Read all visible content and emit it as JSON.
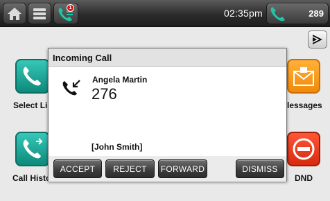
{
  "status_bar": {
    "time": "02:35pm",
    "line_number": "289",
    "missed_calls_badge": "1"
  },
  "tiles": {
    "select_line": "Select Li",
    "messages": "lessages",
    "call_history": "Call Histo",
    "dnd": "DND"
  },
  "icons": {
    "home": "home-icon",
    "list": "list-icon",
    "call_log": "call-log-icon",
    "line": "phone-icon",
    "next_page": "play-arrow-icon",
    "message": "envelope-icon",
    "dnd": "no-entry-icon",
    "incoming": "incoming-call-icon"
  },
  "colors": {
    "accent_teal": "#14a394",
    "accent_orange": "#f5960f",
    "accent_red": "#e8361a",
    "badge_red": "#e01010"
  },
  "incoming_call": {
    "title": "Incoming Call",
    "caller_name": "Angela Martin",
    "caller_number": "276",
    "target": "[John Smith]",
    "buttons": {
      "accept": "ACCEPT",
      "reject": "REJECT",
      "forward": "FORWARD",
      "dismiss": "DISMISS"
    }
  }
}
